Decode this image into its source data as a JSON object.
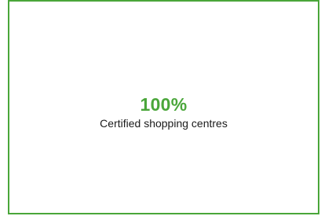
{
  "card": {
    "accent_color": "#4aa63a",
    "stat_value": "100%",
    "stat_label": "Certified shopping centres"
  }
}
